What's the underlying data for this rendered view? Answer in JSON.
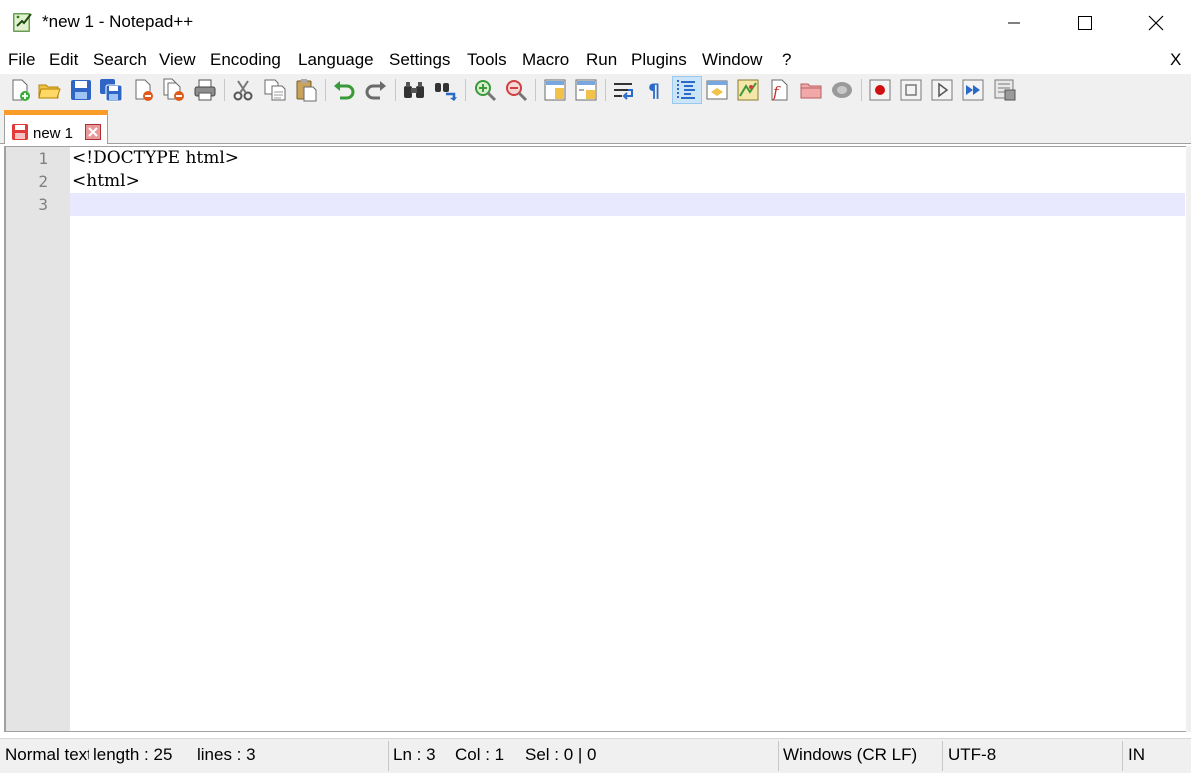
{
  "window": {
    "title": "*new 1 - Notepad++",
    "minimize_glyph": "—",
    "maximize_glyph": "☐",
    "close_glyph": "✕"
  },
  "menu": {
    "items": [
      "File",
      "Edit",
      "Search",
      "View",
      "Encoding",
      "Language",
      "Settings",
      "Tools",
      "Macro",
      "Run",
      "Plugins",
      "Window",
      "?"
    ],
    "close_doc": "X"
  },
  "toolbar": {
    "icons": [
      "new-file-icon",
      "open-file-icon",
      "save-icon",
      "save-all-icon",
      "close-icon",
      "close-all-icon",
      "print-icon",
      "cut-icon",
      "copy-icon",
      "paste-icon",
      "undo-icon",
      "redo-icon",
      "find-icon",
      "replace-icon",
      "zoom-in-icon",
      "zoom-out-icon",
      "sync-vertical-icon",
      "sync-horizontal-icon",
      "word-wrap-icon",
      "show-all-chars-icon",
      "indent-guide-icon",
      "udl-icon",
      "doc-map-icon",
      "function-list-icon",
      "folder-workspace-icon",
      "monitoring-icon",
      "record-macro-icon",
      "stop-record-icon",
      "playback-macro-icon",
      "run-multiple-macro-icon",
      "save-macro-icon"
    ],
    "active_icon": "indent-guide-icon"
  },
  "tabs": [
    {
      "label": "new 1",
      "modified": true
    }
  ],
  "editor": {
    "lines": [
      {
        "number": "1",
        "text": "<!DOCTYPE html>"
      },
      {
        "number": "2",
        "text": "<html>"
      },
      {
        "number": "3",
        "text": ""
      }
    ],
    "current_line": 3,
    "current_line_color": "#e8e8ff"
  },
  "status": {
    "file_type": "Normal text file",
    "length": "length : 25",
    "lines": "lines : 3",
    "ln": "Ln : 3",
    "col": "Col : 1",
    "sel": "Sel : 0 | 0",
    "eol": "Windows (CR LF)",
    "encoding": "UTF-8",
    "mode": "IN"
  }
}
